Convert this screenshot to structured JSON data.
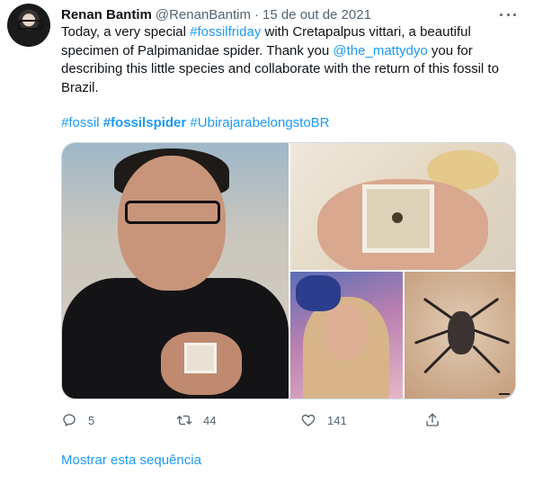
{
  "tweet": {
    "author_name": "Renan Bantim",
    "handle": "@RenanBantim",
    "separator": "·",
    "date": "15 de out de 2021",
    "text_lines": [
      [
        {
          "t": "Today, a very special ",
          "link": false
        },
        {
          "t": "#fossilfriday",
          "link": true
        },
        {
          "t": " with Cretapalpus vittari, a beautiful",
          "link": false
        }
      ],
      [
        {
          "t": "specimen of Palpimanidae spider. Thank you ",
          "link": false
        },
        {
          "t": "@the_mattydyo",
          "link": true
        },
        {
          "t": " you for",
          "link": false
        }
      ],
      [
        {
          "t": "describing this little species and collaborate with the return of this fossil to",
          "link": false
        }
      ],
      [
        {
          "t": "Brazil.",
          "link": false
        }
      ]
    ],
    "hashtags": {
      "tag1": "#fossil",
      "tag2": "#fossilspider",
      "tag3": "#UbirajarabelongstoBR"
    },
    "media": {
      "photo1": "man holding fossil box",
      "photo2": "fossil cube in hand",
      "photo3": "performer portrait",
      "photo4": "spider illustration"
    },
    "actions": {
      "reply_count": "5",
      "retweet_count": "44",
      "like_count": "141"
    },
    "show_thread": "Mostrar esta sequência"
  },
  "icons": {
    "more": "more-horizontal-icon",
    "reply": "reply-icon",
    "retweet": "retweet-icon",
    "like": "heart-icon",
    "share": "share-icon"
  },
  "colors": {
    "link": "#1d9bf0",
    "muted": "#536471",
    "text": "#0f1419"
  }
}
